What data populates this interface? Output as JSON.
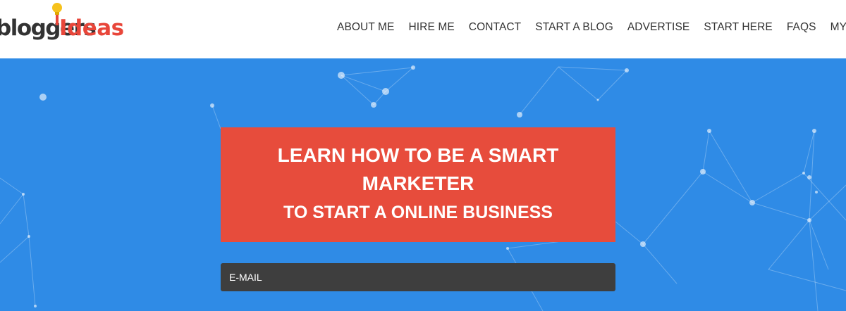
{
  "header": {
    "logo": {
      "text_main": "bloggers",
      "text_accent": "Ideas"
    },
    "nav": [
      {
        "label": "ABOUT ME"
      },
      {
        "label": "HIRE ME"
      },
      {
        "label": "CONTACT"
      },
      {
        "label": "START A BLOG"
      },
      {
        "label": "ADVERTISE"
      },
      {
        "label": "START HERE"
      },
      {
        "label": "FAQS"
      },
      {
        "label": "MY TOOLS"
      }
    ]
  },
  "hero": {
    "headline": "LEARN HOW TO BE A SMART MARKETER",
    "subheadline": "TO START A ONLINE BUSINESS",
    "email_label": "E-MAIL"
  },
  "colors": {
    "hero_background": "#2f8be6",
    "banner_background": "#e74c3c",
    "input_background": "#3e3e3e",
    "logo_accent": "#e8463a",
    "bulb": "#f6c21c"
  },
  "icons": {
    "logo_bulb": "lightbulb-icon"
  }
}
